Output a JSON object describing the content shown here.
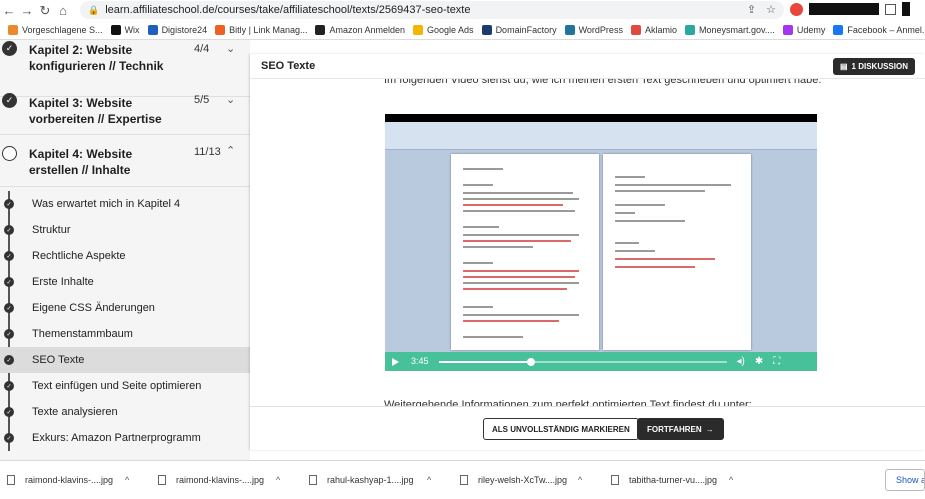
{
  "browser": {
    "url": "learn.affiliateschool.de/courses/take/affiliateschool/texts/2569437-seo-texte"
  },
  "bookmarks": [
    {
      "label": "Vorgeschlagene S...",
      "icon": "bookmark-icon",
      "color": "#e98a2c"
    },
    {
      "label": "Wix",
      "icon": "wix-icon",
      "color": "#111111"
    },
    {
      "label": "Digistore24",
      "icon": "digistore-icon",
      "color": "#1f5fbf"
    },
    {
      "label": "Bitly | Link Manag...",
      "icon": "bitly-icon",
      "color": "#ee6123"
    },
    {
      "label": "Amazon Anmelden",
      "icon": "amazon-icon",
      "color": "#222222"
    },
    {
      "label": "Google Ads",
      "icon": "google-ads-icon",
      "color": "#f4b400"
    },
    {
      "label": "DomainFactory",
      "icon": "domainfactory-icon",
      "color": "#1c3c6e"
    },
    {
      "label": "WordPress",
      "icon": "wordpress-icon",
      "color": "#21759b"
    },
    {
      "label": "Aklamio",
      "icon": "aklamio-icon",
      "color": "#e04a3f"
    },
    {
      "label": "Moneysmart.gov....",
      "icon": "moneysmart-icon",
      "color": "#2aa7a0"
    },
    {
      "label": "Udemy",
      "icon": "udemy-icon",
      "color": "#a435f0"
    },
    {
      "label": "Facebook – Anmel...",
      "icon": "facebook-icon",
      "color": "#1877f2"
    }
  ],
  "sidebar": {
    "chapters": [
      {
        "title": "Kapitel 2: Website konfigurieren // Technik",
        "count": "4/4",
        "status": "complete"
      },
      {
        "title": "Kapitel 3: Website vorbereiten // Expertise",
        "count": "5/5",
        "status": "complete"
      },
      {
        "title": "Kapitel 4: Website erstellen // Inhalte",
        "count": "11/13",
        "status": "in-progress"
      }
    ],
    "lessons": [
      {
        "label": "Was erwartet mich in Kapitel 4"
      },
      {
        "label": "Struktur"
      },
      {
        "label": "Rechtliche Aspekte"
      },
      {
        "label": "Erste Inhalte"
      },
      {
        "label": "Eigene CSS Änderungen"
      },
      {
        "label": "Themenstammbaum"
      },
      {
        "label": "SEO Texte"
      },
      {
        "label": "Text einfügen und Seite optimieren"
      },
      {
        "label": "Texte analysieren"
      },
      {
        "label": "Exkurs: Amazon Partnerprogramm"
      }
    ]
  },
  "main": {
    "title": "SEO Texte",
    "discussion_label": "1 DISKUSSION",
    "intro_text": "Im folgenden Video siehst du, wie ich meinen ersten Text geschrieben und optimiert habe:",
    "outro_text": "Weitergehende Informationen zum perfekt optimierten Text findest du unter:",
    "video": {
      "time": "3:45",
      "progress": 0.32
    },
    "mark_incomplete_label": "ALS UNVOLLSTÄNDIG MARKIEREN",
    "continue_label": "FORTFAHREN",
    "accent": "#47c19a"
  },
  "downloads": {
    "items": [
      {
        "name": "raimond-klavins-....jpg"
      },
      {
        "name": "raimond-klavins-....jpg"
      },
      {
        "name": "rahul-kashyap-1....jpg"
      },
      {
        "name": "riley-welsh-XcTw....jpg"
      },
      {
        "name": "tabitha-turner-vu....jpg"
      }
    ],
    "show_all_label": "Show all"
  }
}
